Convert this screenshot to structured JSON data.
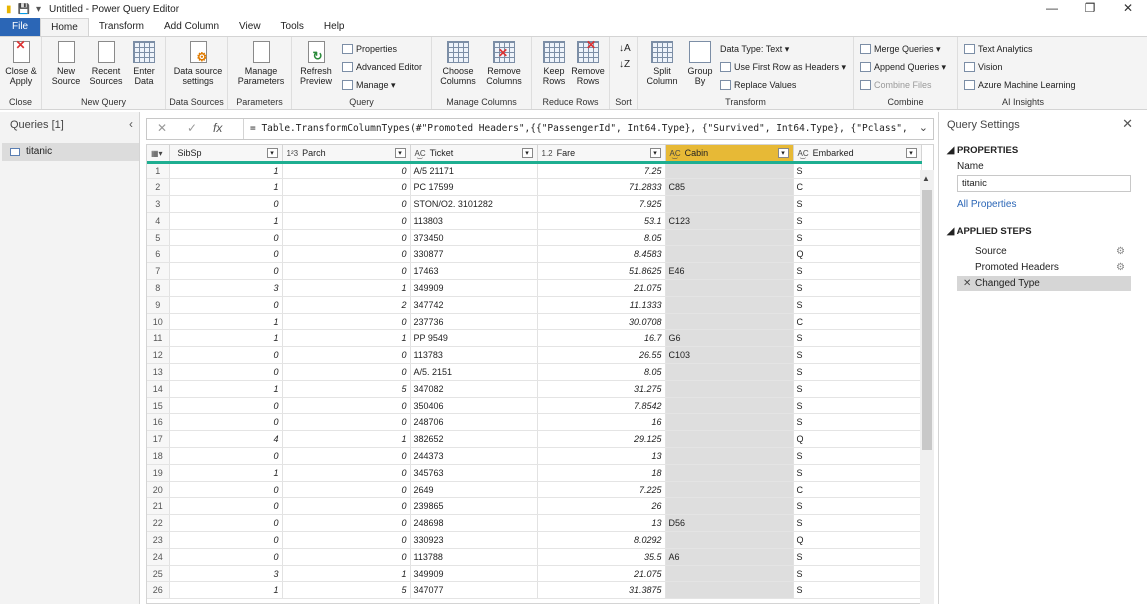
{
  "window": {
    "title": "Untitled - Power Query Editor"
  },
  "menu_tabs": [
    "File",
    "Home",
    "Transform",
    "Add Column",
    "View",
    "Tools",
    "Help"
  ],
  "ribbon": {
    "close": {
      "btn1": "Close &",
      "btn2": "Apply",
      "label": "Close"
    },
    "new_query": {
      "new1": "New",
      "new2": "Source",
      "recent1": "Recent",
      "recent2": "Sources",
      "enter1": "Enter",
      "enter2": "Data",
      "label": "New Query"
    },
    "data_sources": {
      "btn1": "Data source",
      "btn2": "settings",
      "label": "Data Sources"
    },
    "parameters": {
      "btn1": "Manage",
      "btn2": "Parameters",
      "label": "Parameters"
    },
    "query": {
      "refresh1": "Refresh",
      "refresh2": "Preview",
      "properties": "Properties",
      "advanced": "Advanced Editor",
      "manage": "Manage",
      "label": "Query"
    },
    "manage_columns": {
      "choose1": "Choose",
      "choose2": "Columns",
      "remove1": "Remove",
      "remove2": "Columns",
      "label": "Manage Columns"
    },
    "reduce_rows": {
      "keep1": "Keep",
      "keep2": "Rows",
      "remove1": "Remove",
      "remove2": "Rows",
      "label": "Reduce Rows"
    },
    "sort": {
      "label": "Sort"
    },
    "transform": {
      "split1": "Split",
      "split2": "Column",
      "group1": "Group",
      "group2": "By",
      "datatype": "Data Type: Text",
      "firstrow": "Use First Row as Headers",
      "replace": "Replace Values",
      "label": "Transform"
    },
    "combine": {
      "merge": "Merge Queries",
      "append": "Append Queries",
      "combine": "Combine Files",
      "label": "Combine"
    },
    "ai": {
      "text": "Text Analytics",
      "vision": "Vision",
      "azure": "Azure Machine Learning",
      "label": "AI Insights"
    }
  },
  "queries": {
    "header": "Queries [1]",
    "items": [
      "titanic"
    ]
  },
  "formula": "= Table.TransformColumnTypes(#\"Promoted Headers\",{{\"PassengerId\", Int64.Type}, {\"Survived\", Int64.Type}, {\"Pclass\",",
  "table": {
    "columns": [
      {
        "name": "SibSp",
        "type": ""
      },
      {
        "name": "Parch",
        "type": "1²3"
      },
      {
        "name": "Ticket",
        "type": "A͜C"
      },
      {
        "name": "Fare",
        "type": "1.2"
      },
      {
        "name": "Cabin",
        "type": "A͜C"
      },
      {
        "name": "Embarked",
        "type": "A͜C"
      }
    ],
    "rows": [
      [
        "1",
        "0",
        "A/5 21171",
        "7.25",
        "",
        "S"
      ],
      [
        "1",
        "0",
        "PC 17599",
        "71.2833",
        "C85",
        "C"
      ],
      [
        "0",
        "0",
        "STON/O2. 3101282",
        "7.925",
        "",
        "S"
      ],
      [
        "1",
        "0",
        "113803",
        "53.1",
        "C123",
        "S"
      ],
      [
        "0",
        "0",
        "373450",
        "8.05",
        "",
        "S"
      ],
      [
        "0",
        "0",
        "330877",
        "8.4583",
        "",
        "Q"
      ],
      [
        "0",
        "0",
        "17463",
        "51.8625",
        "E46",
        "S"
      ],
      [
        "3",
        "1",
        "349909",
        "21.075",
        "",
        "S"
      ],
      [
        "0",
        "2",
        "347742",
        "11.1333",
        "",
        "S"
      ],
      [
        "1",
        "0",
        "237736",
        "30.0708",
        "",
        "C"
      ],
      [
        "1",
        "1",
        "PP 9549",
        "16.7",
        "G6",
        "S"
      ],
      [
        "0",
        "0",
        "113783",
        "26.55",
        "C103",
        "S"
      ],
      [
        "0",
        "0",
        "A/5. 2151",
        "8.05",
        "",
        "S"
      ],
      [
        "1",
        "5",
        "347082",
        "31.275",
        "",
        "S"
      ],
      [
        "0",
        "0",
        "350406",
        "7.8542",
        "",
        "S"
      ],
      [
        "0",
        "0",
        "248706",
        "16",
        "",
        "S"
      ],
      [
        "4",
        "1",
        "382652",
        "29.125",
        "",
        "Q"
      ],
      [
        "0",
        "0",
        "244373",
        "13",
        "",
        "S"
      ],
      [
        "1",
        "0",
        "345763",
        "18",
        "",
        "S"
      ],
      [
        "0",
        "0",
        "2649",
        "7.225",
        "",
        "C"
      ],
      [
        "0",
        "0",
        "239865",
        "26",
        "",
        "S"
      ],
      [
        "0",
        "0",
        "248698",
        "13",
        "D56",
        "S"
      ],
      [
        "0",
        "0",
        "330923",
        "8.0292",
        "",
        "Q"
      ],
      [
        "0",
        "0",
        "113788",
        "35.5",
        "A6",
        "S"
      ],
      [
        "3",
        "1",
        "349909",
        "21.075",
        "",
        "S"
      ],
      [
        "1",
        "5",
        "347077",
        "31.3875",
        "",
        "S"
      ]
    ]
  },
  "settings": {
    "header": "Query Settings",
    "properties": "PROPERTIES",
    "name_label": "Name",
    "name_value": "titanic",
    "all_properties": "All Properties",
    "applied_steps": "APPLIED STEPS",
    "steps": [
      "Source",
      "Promoted Headers",
      "Changed Type"
    ]
  }
}
